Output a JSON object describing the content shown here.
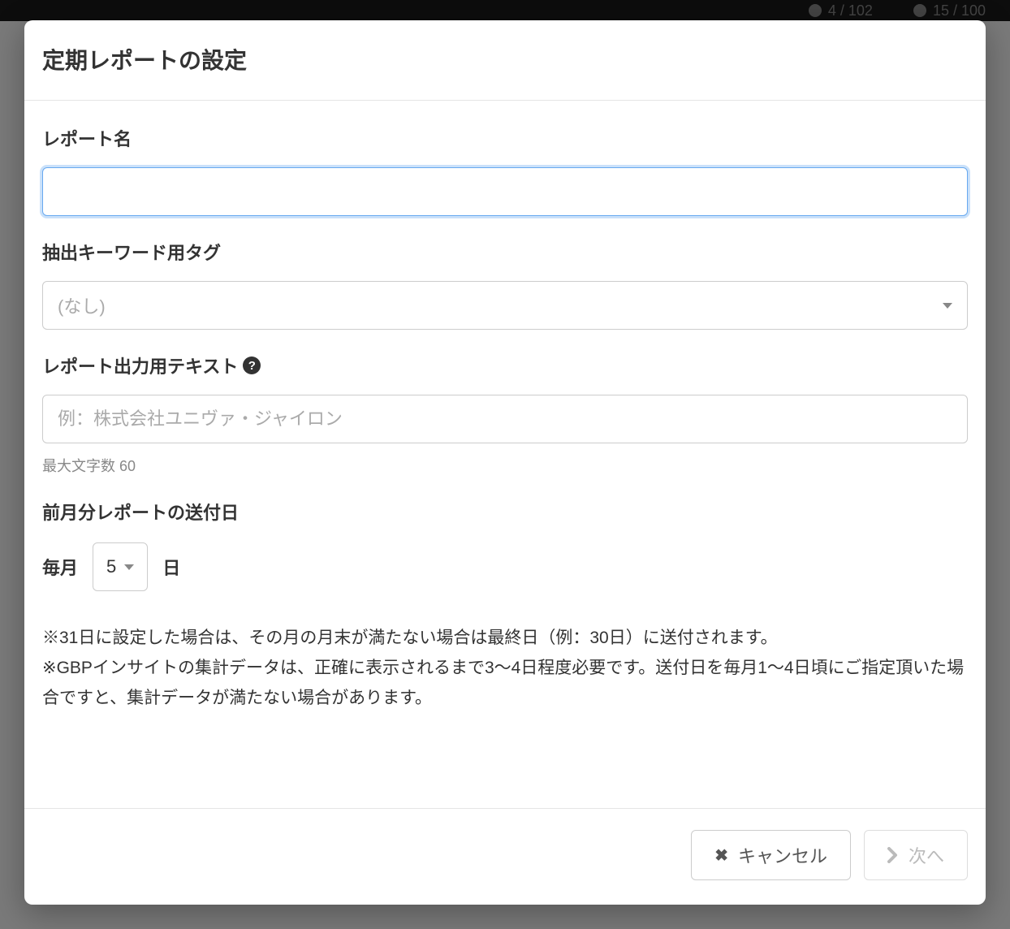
{
  "topbar": {
    "stat1": "4 / 102",
    "stat2": "15 / 100"
  },
  "modal": {
    "title": "定期レポートの設定"
  },
  "form": {
    "report_name": {
      "label": "レポート名",
      "value": ""
    },
    "keyword_tag": {
      "label": "抽出キーワード用タグ",
      "selected": "(なし)"
    },
    "output_text": {
      "label": "レポート出力用テキスト",
      "placeholder": "例：株式会社ユニヴァ・ジャイロン",
      "helper": "最大文字数 60",
      "value": ""
    },
    "send_day": {
      "label": "前月分レポートの送付日",
      "prefix": "毎月",
      "value": "5",
      "suffix": "日"
    },
    "note1": "※31日に設定した場合は、その月の月末が満たない場合は最終日（例：30日）に送付されます。",
    "note2": "※GBPインサイトの集計データは、正確に表示されるまで3〜4日程度必要です。送付日を毎月1〜4日頃にご指定頂いた場合ですと、集計データが満たない場合があります。"
  },
  "footer": {
    "cancel": "キャンセル",
    "next": "次へ"
  }
}
